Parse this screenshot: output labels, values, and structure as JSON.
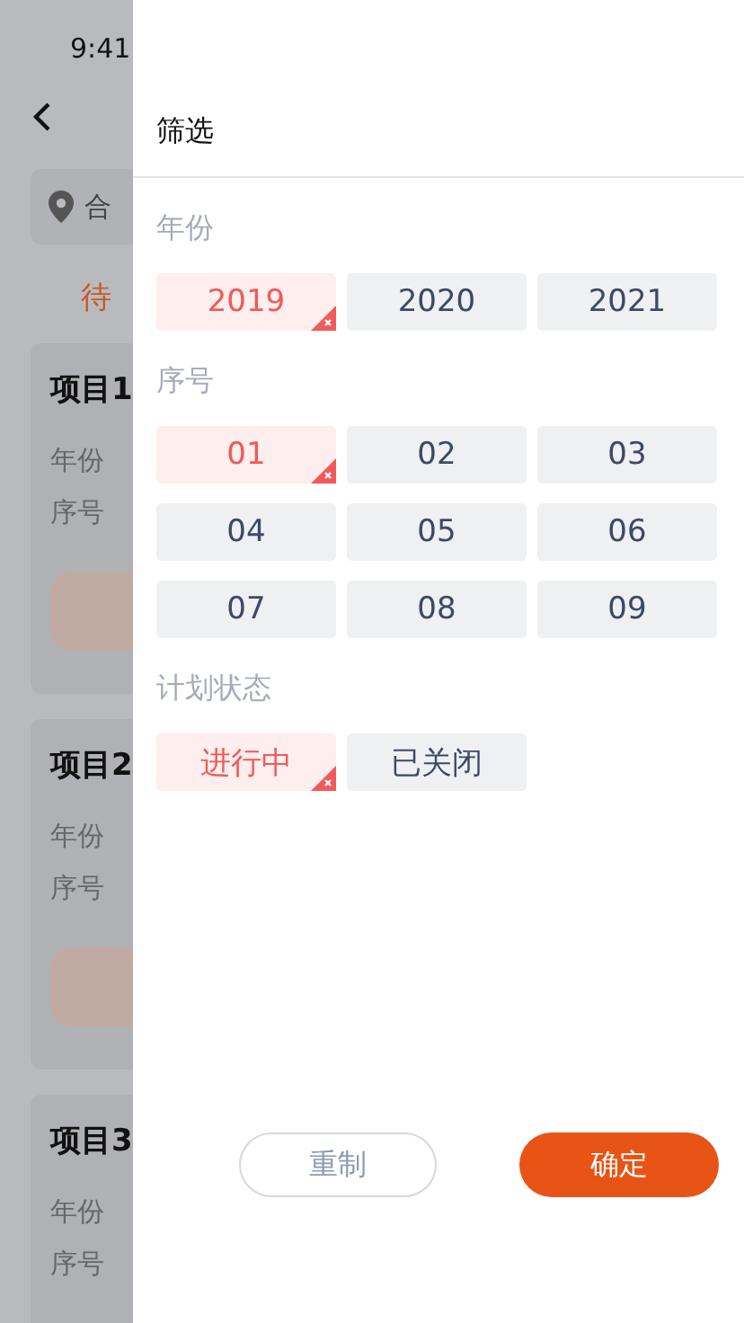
{
  "background": {
    "status_time": "9:41",
    "location": "合",
    "tab": "待",
    "cards": [
      {
        "title": "项目1",
        "labels": [
          "年份",
          "序号"
        ]
      },
      {
        "title": "项目2",
        "labels": [
          "年份",
          "序号"
        ]
      },
      {
        "title": "项目3",
        "labels": [
          "年份",
          "序号"
        ]
      }
    ]
  },
  "drawer": {
    "title": "筛选",
    "sections": [
      {
        "label": "年份",
        "options": [
          {
            "text": "2019",
            "selected": true
          },
          {
            "text": "2020",
            "selected": false
          },
          {
            "text": "2021",
            "selected": false
          }
        ]
      },
      {
        "label": "序号",
        "options": [
          {
            "text": "01",
            "selected": true
          },
          {
            "text": "02",
            "selected": false
          },
          {
            "text": "03",
            "selected": false
          },
          {
            "text": "04",
            "selected": false
          },
          {
            "text": "05",
            "selected": false
          },
          {
            "text": "06",
            "selected": false
          },
          {
            "text": "07",
            "selected": false
          },
          {
            "text": "08",
            "selected": false
          },
          {
            "text": "09",
            "selected": false
          }
        ]
      },
      {
        "label": "计划状态",
        "options": [
          {
            "text": "进行中",
            "selected": true
          },
          {
            "text": "已关闭",
            "selected": false
          }
        ]
      }
    ],
    "reset": "重制",
    "confirm": "确定"
  }
}
